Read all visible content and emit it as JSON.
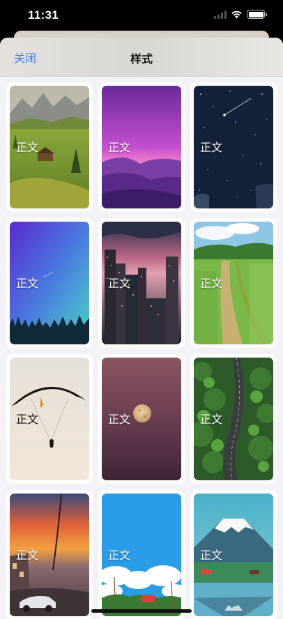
{
  "status_bar": {
    "time": "11:31",
    "battery_level": 1.0
  },
  "nav": {
    "close_label": "关闭",
    "title": "样式"
  },
  "tiles": [
    {
      "label": "正文",
      "scene": "alpine-meadow",
      "label_color": "#ffffff"
    },
    {
      "label": "正文",
      "scene": "purple-mountains",
      "label_color": "#ffffff"
    },
    {
      "label": "正文",
      "scene": "starry-night",
      "label_color": "#ffffff"
    },
    {
      "label": "正文",
      "scene": "twilight-forest",
      "label_color": "#ffffff"
    },
    {
      "label": "正文",
      "scene": "city-dusk",
      "label_color": "#ffffff"
    },
    {
      "label": "正文",
      "scene": "green-fields-road",
      "label_color": "#ffffff"
    },
    {
      "label": "正文",
      "scene": "paraglider",
      "label_color": "#111111"
    },
    {
      "label": "正文",
      "scene": "moon-dusk",
      "label_color": "#ffffff"
    },
    {
      "label": "正文",
      "scene": "forest-road",
      "label_color": "#ffffff"
    },
    {
      "label": "正文",
      "scene": "sunset-street",
      "label_color": "#ffffff"
    },
    {
      "label": "正文",
      "scene": "blue-sky-clouds",
      "label_color": "#ffffff"
    },
    {
      "label": "正文",
      "scene": "mount-fuji",
      "label_color": "#ffffff"
    }
  ]
}
